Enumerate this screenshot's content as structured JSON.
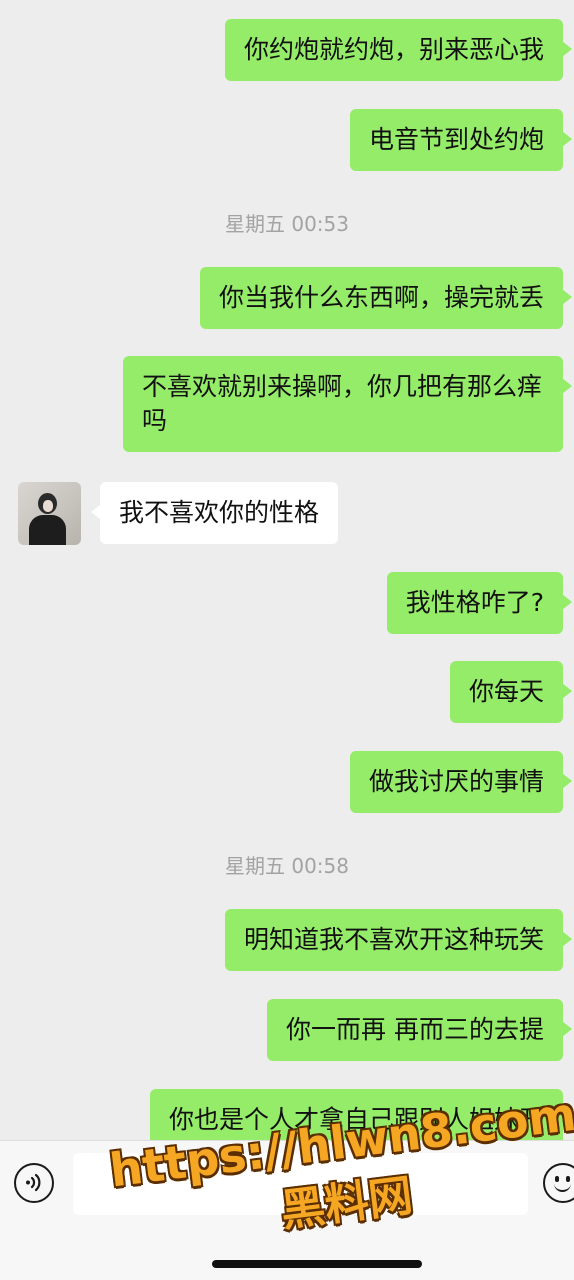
{
  "messages": [
    {
      "text": "你约炮就约炮，别来恶心我"
    },
    {
      "text": "电音节到处约炮"
    },
    {
      "time": "星期五 00:53"
    },
    {
      "text": "你当我什么东西啊，操完就丢"
    },
    {
      "text": "不喜欢就别来操啊，你几把有那么痒吗"
    },
    {
      "text": "我不喜欢你的性格"
    },
    {
      "text": "我性格咋了?"
    },
    {
      "text": "你每天"
    },
    {
      "text": "做我讨厌的事情"
    },
    {
      "time": "星期五 00:58"
    },
    {
      "text": "明知道我不喜欢开这种玩笑"
    },
    {
      "text": "你一而再 再而三的去提"
    },
    {
      "text": "你也是个人才拿自己跟别人姐妹开"
    }
  ],
  "input": {
    "placeholder": "",
    "voice_icon": "voice-icon",
    "emoji_icon": "emoji-icon"
  },
  "watermark": {
    "url": "https://hlwn8.com",
    "name": "黑料网"
  },
  "colors": {
    "background": "#ededed",
    "outgoing_bubble": "#95ec69",
    "incoming_bubble": "#ffffff",
    "watermark": "#f5a623"
  }
}
